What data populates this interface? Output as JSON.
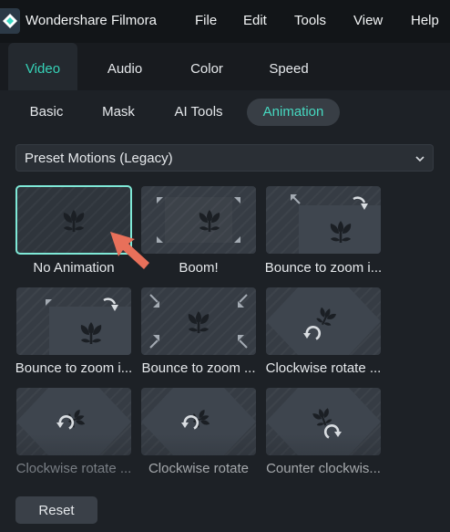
{
  "app": {
    "title": "Wondershare Filmora"
  },
  "menu": [
    "File",
    "Edit",
    "Tools",
    "View",
    "Help"
  ],
  "tabs": [
    {
      "label": "Video",
      "active": true
    },
    {
      "label": "Audio",
      "active": false
    },
    {
      "label": "Color",
      "active": false
    },
    {
      "label": "Speed",
      "active": false
    }
  ],
  "subtabs": [
    {
      "label": "Basic",
      "active": false
    },
    {
      "label": "Mask",
      "active": false
    },
    {
      "label": "AI Tools",
      "active": false
    },
    {
      "label": "Animation",
      "active": true
    }
  ],
  "preset_dropdown": {
    "value": "Preset Motions (Legacy)"
  },
  "presets": [
    {
      "label": "No Animation",
      "selected": true,
      "icon": "flower-icon"
    },
    {
      "label": "Boom!",
      "selected": false,
      "icon": "expand-arrows-icon"
    },
    {
      "label": "Bounce to zoom i...",
      "selected": false,
      "icon": "bounce-zoom-icon"
    },
    {
      "label": "Bounce to zoom i...",
      "selected": false,
      "icon": "bounce-zoom-icon"
    },
    {
      "label": "Bounce to zoom ...",
      "selected": false,
      "icon": "zoom-arrows-icon"
    },
    {
      "label": "Clockwise rotate ...",
      "selected": false,
      "icon": "rotate-clockwise-icon"
    },
    {
      "label": "Clockwise rotate ...",
      "selected": false,
      "icon": "rotate-clockwise-icon"
    },
    {
      "label": "Clockwise rotate",
      "selected": false,
      "icon": "rotate-clockwise-icon"
    },
    {
      "label": "Counter clockwis...",
      "selected": false,
      "icon": "rotate-counterclockwise-icon"
    }
  ],
  "footer": {
    "reset_label": "Reset"
  },
  "colors": {
    "accent": "#36d3b8",
    "selection": "#7fe9d7",
    "pointer": "#e8705a"
  }
}
